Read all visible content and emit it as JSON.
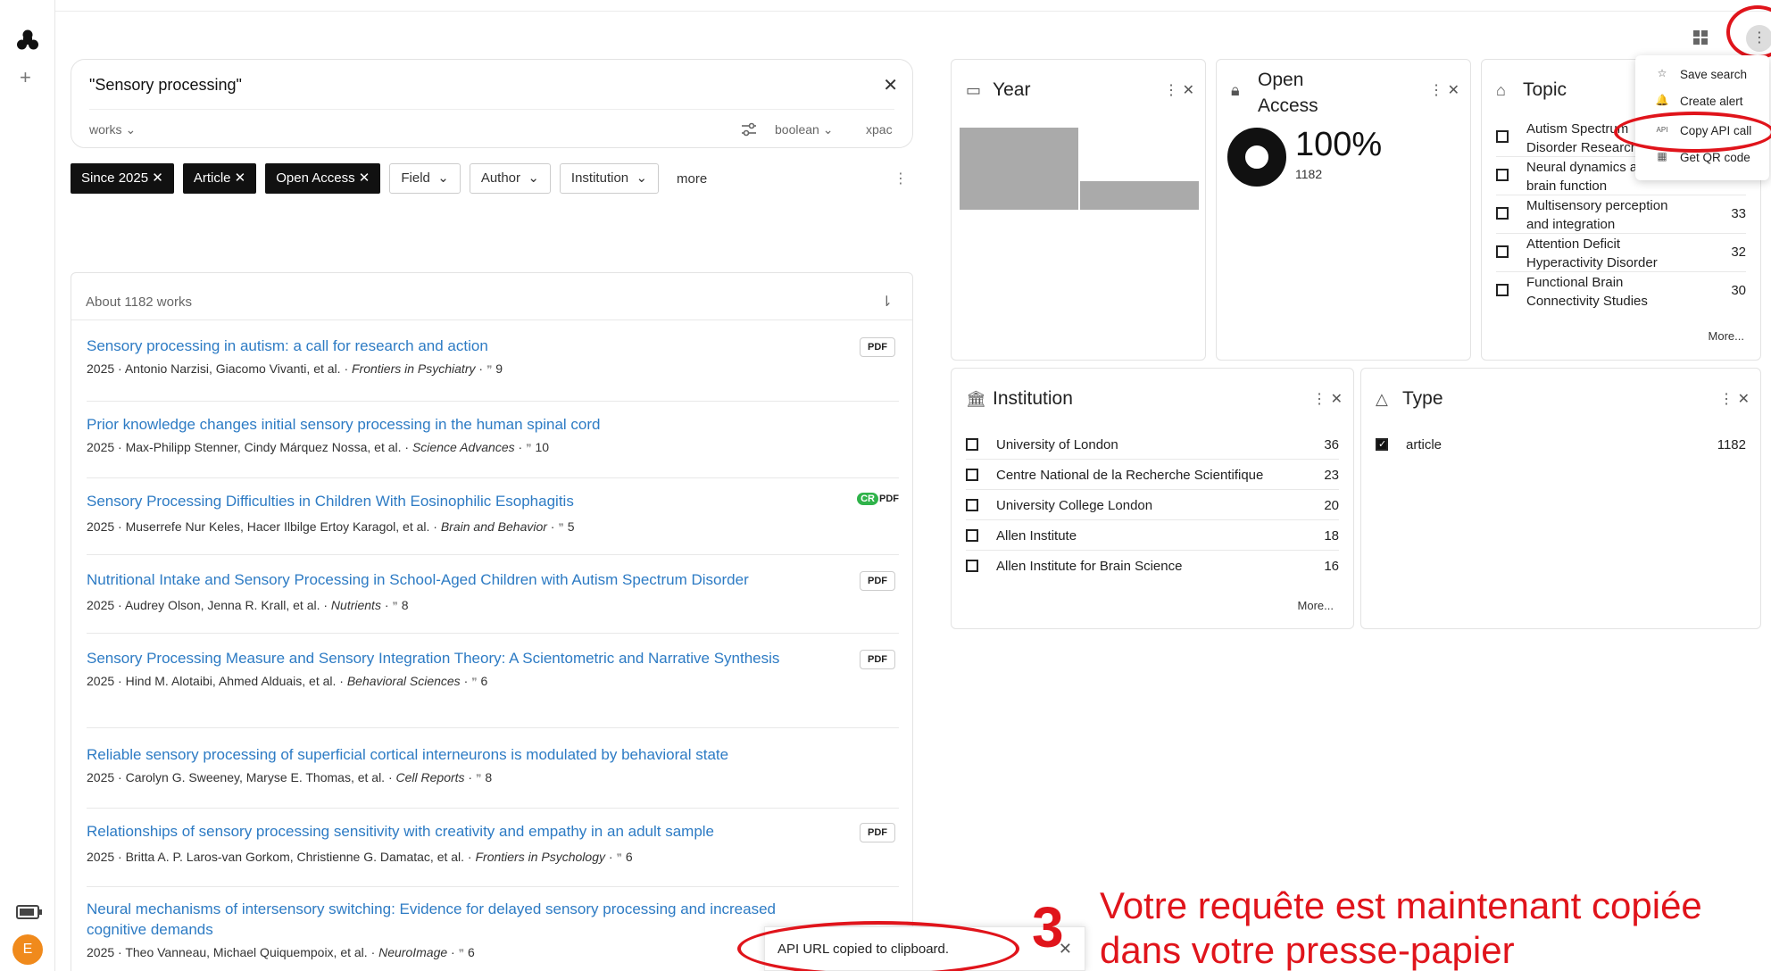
{
  "search": {
    "query": "\"Sensory processing\"",
    "entity_select": "works",
    "mode_select": "boolean",
    "xpac_label": "xpac"
  },
  "filters": {
    "active": [
      "Since 2025",
      "Article",
      "Open Access"
    ],
    "dropdowns": [
      "Field",
      "Author",
      "Institution"
    ],
    "more_label": "more"
  },
  "results": {
    "summary": "About 1182 works",
    "items": [
      {
        "title": "Sensory processing in autism: a call for research and action",
        "meta": "2025 · Antonio Narzisi, Giacomo Vivanti, et al. · ",
        "venue": "Frontiers in Psychiatry",
        "cites": "9",
        "badge": "PDF"
      },
      {
        "title": "Prior knowledge changes initial sensory processing in the human spinal cord",
        "meta": "2025 · Max-Philipp Stenner, Cindy Márquez Nossa, et al. · ",
        "venue": "Science Advances",
        "cites": "10",
        "badge": ""
      },
      {
        "title": "Sensory Processing Difficulties in Children With Eosinophilic Esophagitis",
        "meta": "2025 · Muserrefe Nur Keles, Hacer Ilbilge Ertoy Karagol, et al. · ",
        "venue": "Brain and Behavior",
        "cites": "5",
        "badge": "CR PDF"
      },
      {
        "title": "Nutritional Intake and Sensory Processing in School-Aged Children with Autism Spectrum Disorder",
        "meta": "2025 · Audrey Olson, Jenna R. Krall, et al. · ",
        "venue": "Nutrients",
        "cites": "8",
        "badge": "PDF"
      },
      {
        "title": "Sensory Processing Measure and Sensory Integration Theory: A Scientometric and Narrative Synthesis",
        "meta": "2025 · Hind M. Alotaibi, Ahmed Alduais, et al. · ",
        "venue": "Behavioral Sciences",
        "cites": "6",
        "badge": "PDF"
      },
      {
        "title": "Reliable sensory processing of superficial cortical interneurons is modulated by behavioral state",
        "meta": "2025 · Carolyn G. Sweeney, Maryse E. Thomas, et al. · ",
        "venue": "Cell Reports",
        "cites": "8",
        "badge": ""
      },
      {
        "title": "Relationships of sensory processing sensitivity with creativity and empathy in an adult sample",
        "meta": "2025 · Britta A. P. Laros-van Gorkom, Christienne G. Damatac, et al. · ",
        "venue": "Frontiers in Psychology",
        "cites": "6",
        "badge": "PDF"
      },
      {
        "title": "Neural mechanisms of intersensory switching: Evidence for delayed sensory processing and increased cognitive demands",
        "meta": "2025 · Theo Vanneau, Michael Quiquempoix, et al. · ",
        "venue": "NeuroImage",
        "cites": "6",
        "badge": ""
      }
    ]
  },
  "year_card": {
    "title": "Year",
    "bar_values": [
      1,
      0.35
    ]
  },
  "oa_card": {
    "title": "Open Access",
    "percent": "100%",
    "count": "1182"
  },
  "topic_card": {
    "title": "Topic",
    "items": [
      {
        "label": "Autism Spectrum Disorder Research",
        "count": ""
      },
      {
        "label": "Neural dynamics and brain function",
        "count": ""
      },
      {
        "label": "Multisensory perception and integration",
        "count": "33"
      },
      {
        "label": "Attention Deficit Hyperactivity Disorder",
        "count": "32"
      },
      {
        "label": "Functional Brain Connectivity Studies",
        "count": "30"
      }
    ],
    "more": "More..."
  },
  "institution_card": {
    "title": "Institution",
    "items": [
      {
        "label": "University of London",
        "count": "36"
      },
      {
        "label": "Centre National de la Recherche Scientifique",
        "count": "23"
      },
      {
        "label": "University College London",
        "count": "20"
      },
      {
        "label": "Allen Institute",
        "count": "18"
      },
      {
        "label": "Allen Institute for Brain Science",
        "count": "16"
      }
    ],
    "more": "More..."
  },
  "type_card": {
    "title": "Type",
    "items": [
      {
        "label": "article",
        "count": "1182",
        "checked": true
      }
    ]
  },
  "dropdown_menu": {
    "items": [
      {
        "icon": "☆",
        "label": "Save search"
      },
      {
        "icon": "🔔",
        "label": "Create alert"
      },
      {
        "icon": "API",
        "label": "Copy API call"
      },
      {
        "icon": "▦",
        "label": "Get QR code"
      }
    ]
  },
  "toast": {
    "message": "API URL copied to clipboard."
  },
  "annotation": {
    "step": "3",
    "text": "Votre requête est maintenant copiée dans votre presse-papier"
  },
  "user": {
    "initial": "E"
  },
  "colors": {
    "link": "#2d7bc4",
    "annotation": "#e0141b",
    "avatar": "#f08a1c"
  }
}
